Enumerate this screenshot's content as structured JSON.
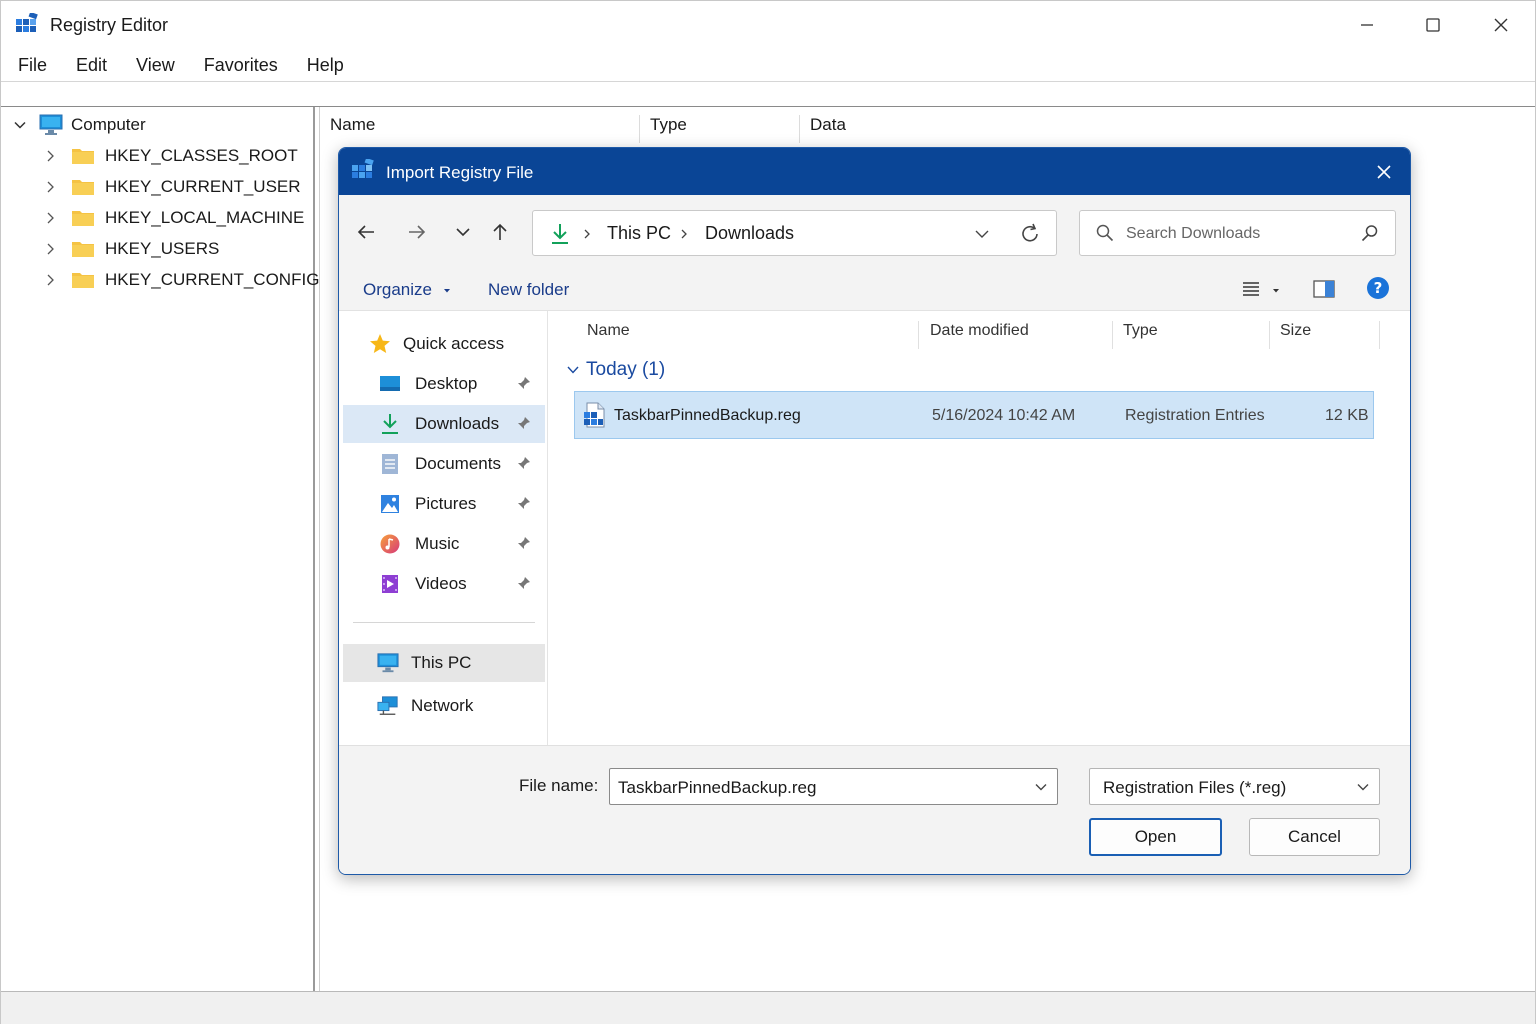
{
  "window": {
    "title": "Registry Editor",
    "controls": {
      "minimize": "minimize",
      "maximize": "maximize",
      "close": "close"
    }
  },
  "menu": [
    "File",
    "Edit",
    "View",
    "Favorites",
    "Help"
  ],
  "tree": {
    "root": "Computer",
    "hives": [
      "HKEY_CLASSES_ROOT",
      "HKEY_CURRENT_USER",
      "HKEY_LOCAL_MACHINE",
      "HKEY_USERS",
      "HKEY_CURRENT_CONFIG"
    ]
  },
  "list_columns": [
    "Name",
    "Type",
    "Data"
  ],
  "dialog": {
    "title": "Import Registry File",
    "breadcrumb": [
      "This PC",
      "Downloads"
    ],
    "search_placeholder": "Search Downloads",
    "commands": {
      "organize": "Organize",
      "new_folder": "New folder"
    },
    "nav": {
      "quick_access": "Quick access",
      "items": [
        {
          "label": "Desktop",
          "icon": "desktop-icon",
          "pinned": true
        },
        {
          "label": "Downloads",
          "icon": "download-icon",
          "pinned": true,
          "selected": true
        },
        {
          "label": "Documents",
          "icon": "documents-icon",
          "pinned": true
        },
        {
          "label": "Pictures",
          "icon": "pictures-icon",
          "pinned": true
        },
        {
          "label": "Music",
          "icon": "music-icon",
          "pinned": true
        },
        {
          "label": "Videos",
          "icon": "videos-icon",
          "pinned": true
        }
      ],
      "this_pc": "This PC",
      "network": "Network"
    },
    "columns": [
      "Name",
      "Date modified",
      "Type",
      "Size"
    ],
    "group": "Today (1)",
    "files": [
      {
        "name": "TaskbarPinnedBackup.reg",
        "date": "5/16/2024 10:42 AM",
        "type": "Registration Entries",
        "size": "12 KB"
      }
    ],
    "file_name_label": "File name:",
    "file_name_value": "TaskbarPinnedBackup.reg",
    "file_type_value": "Registration Files (*.reg)",
    "open_label": "Open",
    "cancel_label": "Cancel"
  },
  "colors": {
    "dialog_title_bg": "#0a4596",
    "selection_bg": "#cfe4f7",
    "accent": "#1a5fb4",
    "folder": "#f5c344"
  }
}
